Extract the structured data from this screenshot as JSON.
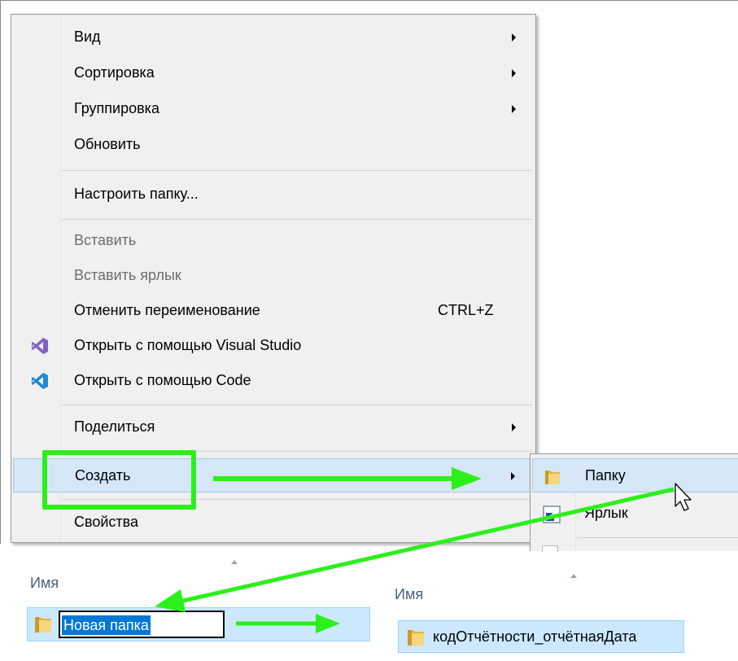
{
  "context_menu": {
    "items": [
      {
        "label": "Вид",
        "has_submenu": true
      },
      {
        "label": "Сортировка",
        "has_submenu": true
      },
      {
        "label": "Группировка",
        "has_submenu": true
      },
      {
        "label": "Обновить"
      },
      {
        "label": "Настроить папку..."
      },
      {
        "label": "Вставить",
        "disabled": true
      },
      {
        "label": "Вставить ярлык",
        "disabled": true
      },
      {
        "label": "Отменить переименование",
        "shortcut": "CTRL+Z"
      },
      {
        "label": "Открыть с помощью Visual Studio",
        "icon": "visual-studio-icon"
      },
      {
        "label": "Открыть с помощью Code",
        "icon": "vscode-icon"
      },
      {
        "label": "Поделиться",
        "has_submenu": true
      },
      {
        "label": "Создать",
        "has_submenu": true,
        "highlighted": true
      },
      {
        "label": "Свойства"
      }
    ]
  },
  "create_submenu": {
    "items": [
      {
        "label": "Папку",
        "icon": "folder-icon",
        "highlighted": true
      },
      {
        "label": "Ярлык",
        "icon": "shortcut-icon"
      }
    ]
  },
  "explorer_left": {
    "column_header": "Имя",
    "new_item_name": "Новая папка"
  },
  "explorer_right": {
    "column_header": "Имя",
    "item_name": "кодОтчётности_отчётнаяДата"
  },
  "colors": {
    "annotation_green": "#2bf01a",
    "highlight_bg": "#d5e6f7",
    "selection_blue": "#0078d7"
  }
}
